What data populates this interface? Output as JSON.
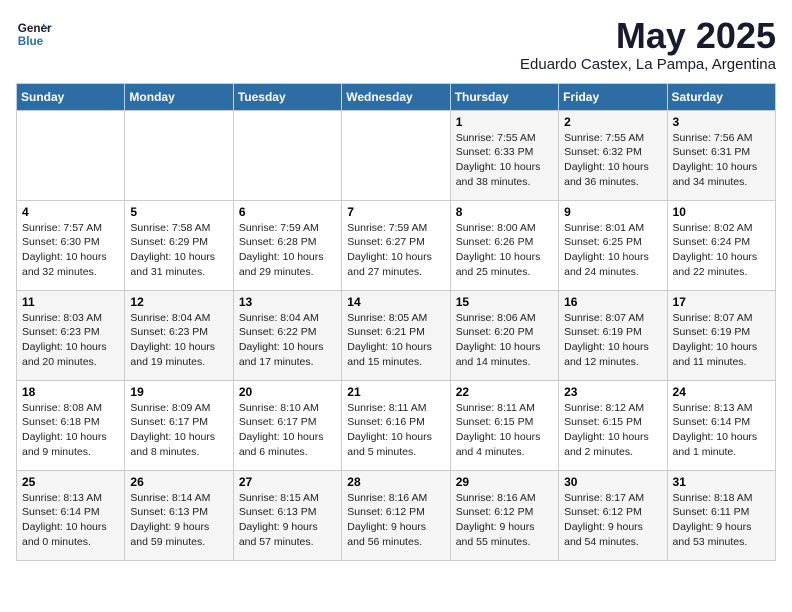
{
  "header": {
    "logo_line1": "General",
    "logo_line2": "Blue",
    "title": "May 2025",
    "subtitle": "Eduardo Castex, La Pampa, Argentina"
  },
  "weekdays": [
    "Sunday",
    "Monday",
    "Tuesday",
    "Wednesday",
    "Thursday",
    "Friday",
    "Saturday"
  ],
  "weeks": [
    [
      {
        "day": "",
        "info": ""
      },
      {
        "day": "",
        "info": ""
      },
      {
        "day": "",
        "info": ""
      },
      {
        "day": "",
        "info": ""
      },
      {
        "day": "1",
        "info": "Sunrise: 7:55 AM\nSunset: 6:33 PM\nDaylight: 10 hours\nand 38 minutes."
      },
      {
        "day": "2",
        "info": "Sunrise: 7:55 AM\nSunset: 6:32 PM\nDaylight: 10 hours\nand 36 minutes."
      },
      {
        "day": "3",
        "info": "Sunrise: 7:56 AM\nSunset: 6:31 PM\nDaylight: 10 hours\nand 34 minutes."
      }
    ],
    [
      {
        "day": "4",
        "info": "Sunrise: 7:57 AM\nSunset: 6:30 PM\nDaylight: 10 hours\nand 32 minutes."
      },
      {
        "day": "5",
        "info": "Sunrise: 7:58 AM\nSunset: 6:29 PM\nDaylight: 10 hours\nand 31 minutes."
      },
      {
        "day": "6",
        "info": "Sunrise: 7:59 AM\nSunset: 6:28 PM\nDaylight: 10 hours\nand 29 minutes."
      },
      {
        "day": "7",
        "info": "Sunrise: 7:59 AM\nSunset: 6:27 PM\nDaylight: 10 hours\nand 27 minutes."
      },
      {
        "day": "8",
        "info": "Sunrise: 8:00 AM\nSunset: 6:26 PM\nDaylight: 10 hours\nand 25 minutes."
      },
      {
        "day": "9",
        "info": "Sunrise: 8:01 AM\nSunset: 6:25 PM\nDaylight: 10 hours\nand 24 minutes."
      },
      {
        "day": "10",
        "info": "Sunrise: 8:02 AM\nSunset: 6:24 PM\nDaylight: 10 hours\nand 22 minutes."
      }
    ],
    [
      {
        "day": "11",
        "info": "Sunrise: 8:03 AM\nSunset: 6:23 PM\nDaylight: 10 hours\nand 20 minutes."
      },
      {
        "day": "12",
        "info": "Sunrise: 8:04 AM\nSunset: 6:23 PM\nDaylight: 10 hours\nand 19 minutes."
      },
      {
        "day": "13",
        "info": "Sunrise: 8:04 AM\nSunset: 6:22 PM\nDaylight: 10 hours\nand 17 minutes."
      },
      {
        "day": "14",
        "info": "Sunrise: 8:05 AM\nSunset: 6:21 PM\nDaylight: 10 hours\nand 15 minutes."
      },
      {
        "day": "15",
        "info": "Sunrise: 8:06 AM\nSunset: 6:20 PM\nDaylight: 10 hours\nand 14 minutes."
      },
      {
        "day": "16",
        "info": "Sunrise: 8:07 AM\nSunset: 6:19 PM\nDaylight: 10 hours\nand 12 minutes."
      },
      {
        "day": "17",
        "info": "Sunrise: 8:07 AM\nSunset: 6:19 PM\nDaylight: 10 hours\nand 11 minutes."
      }
    ],
    [
      {
        "day": "18",
        "info": "Sunrise: 8:08 AM\nSunset: 6:18 PM\nDaylight: 10 hours\nand 9 minutes."
      },
      {
        "day": "19",
        "info": "Sunrise: 8:09 AM\nSunset: 6:17 PM\nDaylight: 10 hours\nand 8 minutes."
      },
      {
        "day": "20",
        "info": "Sunrise: 8:10 AM\nSunset: 6:17 PM\nDaylight: 10 hours\nand 6 minutes."
      },
      {
        "day": "21",
        "info": "Sunrise: 8:11 AM\nSunset: 6:16 PM\nDaylight: 10 hours\nand 5 minutes."
      },
      {
        "day": "22",
        "info": "Sunrise: 8:11 AM\nSunset: 6:15 PM\nDaylight: 10 hours\nand 4 minutes."
      },
      {
        "day": "23",
        "info": "Sunrise: 8:12 AM\nSunset: 6:15 PM\nDaylight: 10 hours\nand 2 minutes."
      },
      {
        "day": "24",
        "info": "Sunrise: 8:13 AM\nSunset: 6:14 PM\nDaylight: 10 hours\nand 1 minute."
      }
    ],
    [
      {
        "day": "25",
        "info": "Sunrise: 8:13 AM\nSunset: 6:14 PM\nDaylight: 10 hours\nand 0 minutes."
      },
      {
        "day": "26",
        "info": "Sunrise: 8:14 AM\nSunset: 6:13 PM\nDaylight: 9 hours\nand 59 minutes."
      },
      {
        "day": "27",
        "info": "Sunrise: 8:15 AM\nSunset: 6:13 PM\nDaylight: 9 hours\nand 57 minutes."
      },
      {
        "day": "28",
        "info": "Sunrise: 8:16 AM\nSunset: 6:12 PM\nDaylight: 9 hours\nand 56 minutes."
      },
      {
        "day": "29",
        "info": "Sunrise: 8:16 AM\nSunset: 6:12 PM\nDaylight: 9 hours\nand 55 minutes."
      },
      {
        "day": "30",
        "info": "Sunrise: 8:17 AM\nSunset: 6:12 PM\nDaylight: 9 hours\nand 54 minutes."
      },
      {
        "day": "31",
        "info": "Sunrise: 8:18 AM\nSunset: 6:11 PM\nDaylight: 9 hours\nand 53 minutes."
      }
    ]
  ]
}
